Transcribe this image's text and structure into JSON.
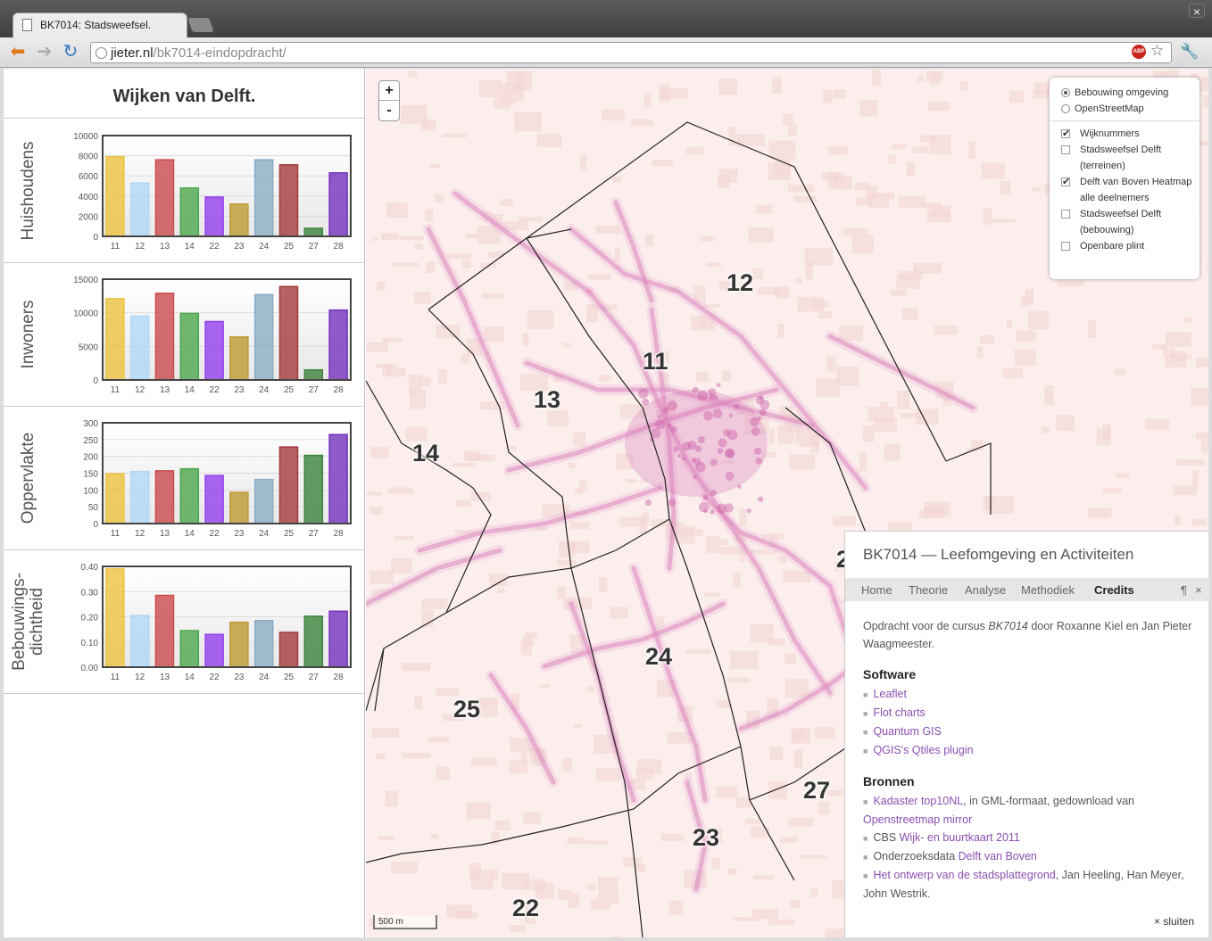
{
  "browser": {
    "tab_title": "BK7014: Stadsweefsel.",
    "url_domain": "jieter.nl",
    "url_path": "/bk7014-eindopdracht/",
    "close_glyph": "×",
    "abp_label": "ABP"
  },
  "page": {
    "title": "Wijken van Delft."
  },
  "charts": [
    {
      "label": "Huishoudens",
      "chart_data": {
        "type": "bar",
        "categories": [
          "11",
          "12",
          "13",
          "14",
          "22",
          "23",
          "24",
          "25",
          "27",
          "28"
        ],
        "values": [
          7900,
          5300,
          7600,
          4800,
          3900,
          3200,
          7600,
          7100,
          800,
          6300
        ],
        "ylim": [
          0,
          10000
        ],
        "yticks": [
          "0",
          "2000",
          "4000",
          "6000",
          "8000",
          "10000"
        ]
      }
    },
    {
      "label": "Inwoners",
      "chart_data": {
        "type": "bar",
        "categories": [
          "11",
          "12",
          "13",
          "14",
          "22",
          "23",
          "24",
          "25",
          "27",
          "28"
        ],
        "values": [
          12100,
          9500,
          12900,
          9900,
          8700,
          6400,
          12700,
          13900,
          1500,
          10400
        ],
        "ylim": [
          0,
          15000
        ],
        "yticks": [
          "0",
          "5000",
          "10000",
          "15000"
        ]
      }
    },
    {
      "label": "Oppervlakte",
      "chart_data": {
        "type": "bar",
        "categories": [
          "11",
          "12",
          "13",
          "14",
          "22",
          "23",
          "24",
          "25",
          "27",
          "28"
        ],
        "values": [
          148,
          155,
          157,
          163,
          143,
          93,
          131,
          228,
          203,
          265
        ],
        "ylim": [
          0,
          300
        ],
        "yticks": [
          "0",
          "50",
          "100",
          "150",
          "200",
          "250",
          "300"
        ]
      }
    },
    {
      "label": "Bebouwings-\ndichtheid",
      "label_line1": "Bebouwings-",
      "label_line2": "dichtheid",
      "chart_data": {
        "type": "bar",
        "categories": [
          "11",
          "12",
          "13",
          "14",
          "22",
          "23",
          "24",
          "25",
          "27",
          "28"
        ],
        "values": [
          0.39,
          0.205,
          0.285,
          0.145,
          0.13,
          0.178,
          0.185,
          0.138,
          0.202,
          0.222
        ],
        "ylim": [
          0,
          0.4
        ],
        "yticks": [
          "0.00",
          "0.10",
          "0.20",
          "0.30",
          "0.40"
        ]
      }
    }
  ],
  "bar_colors": [
    "#edc240",
    "#afd8f8",
    "#cb4b4b",
    "#4da74d",
    "#9440ed",
    "#bd9b33",
    "#8cacc6",
    "#a23c3c",
    "#3d853d",
    "#7633bd"
  ],
  "map": {
    "zoom_in": "+",
    "zoom_out": "-",
    "scale_label": "500 m",
    "wijk_labels": [
      "12",
      "11",
      "13",
      "14",
      "24",
      "25",
      "27",
      "23",
      "22",
      "2"
    ],
    "layers": {
      "base": [
        {
          "label": "Bebouwing omgeving",
          "selected": true
        },
        {
          "label": "OpenStreetMap",
          "selected": false
        }
      ],
      "overlays": [
        {
          "label": "Wijknummers",
          "checked": true
        },
        {
          "label": "Stadsweefsel Delft (terreinen)",
          "checked": false
        },
        {
          "label": "Delft van Boven Heatmap alle deelnemers",
          "checked": true
        },
        {
          "label": "Stadsweefsel Delft (bebouwing)",
          "checked": false
        },
        {
          "label": "Openbare plint",
          "checked": false
        }
      ]
    }
  },
  "info": {
    "title": "BK7014 — Leefomgeving en Activiteiten",
    "tabs": [
      "Home",
      "Theorie",
      "Analyse",
      "Methodiek",
      "Credits"
    ],
    "active_tab": "Credits",
    "pilcrow": "¶",
    "close_x": "×",
    "intro_prefix": "Opdracht voor de cursus ",
    "intro_course": "BK7014",
    "intro_suffix": " door Roxanne Kiel en Jan Pieter Waagmeester.",
    "software_heading": "Software",
    "software": [
      "Leaflet",
      "Flot charts",
      "Quantum GIS",
      "QGIS's Qtiles plugin"
    ],
    "bronnen_heading": "Bronnen",
    "bron1_link": "Kadaster top10NL",
    "bron1_text": ", in GML-formaat, gedownload van ",
    "bron1_link2": "Openstreetmap mirror",
    "bron2_prefix": "CBS ",
    "bron2_link": "Wijk- en buurtkaart 2011",
    "bron3_prefix": "Onderzoeksdata ",
    "bron3_link": "Delft van Boven",
    "bron4_link": "Het ontwerp van de stadsplattegrond",
    "bron4_text": ", Jan Heeling, Han Meyer, John Westrik.",
    "close_label": "× sluiten"
  }
}
